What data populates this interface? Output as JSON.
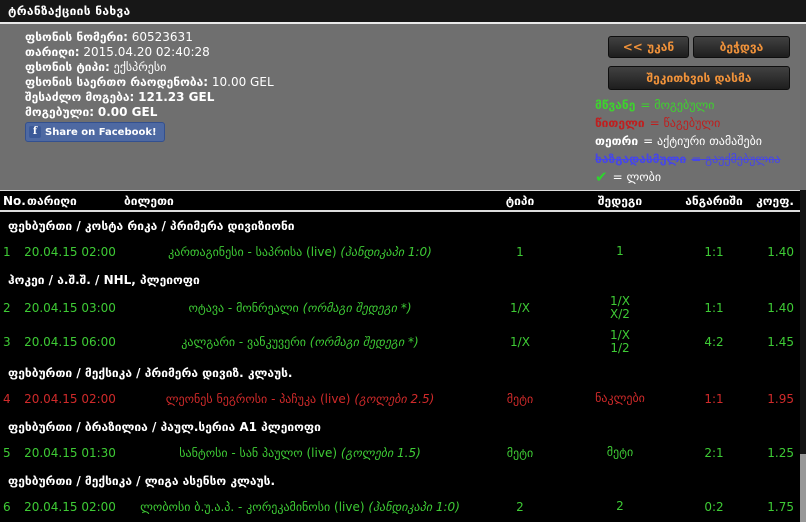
{
  "title": "ტრანზაქციის ნახვა",
  "colors": {
    "won_green": "#3ecb35",
    "lost_red": "#cf2a2a",
    "legend_green": "#3ed32e",
    "legend_red": "#bf1f1f",
    "legend_white": "#ffffff",
    "legend_blue": "#4646e8",
    "accent_orange": "#f0923a",
    "facebook_blue": "#4e69a2",
    "check_green": "#2ed32e"
  },
  "info": {
    "fields": [
      {
        "label": "ფსონის ნომერი:",
        "value": "60523631"
      },
      {
        "label": "თარიღი:",
        "value": "2015.04.20 02:40:28"
      },
      {
        "label": "ფსონის ტიპი:",
        "value": "ექსპრესი"
      },
      {
        "label": "ფსონის საერთო რაოდენობა:",
        "value": "10.00 GEL"
      },
      {
        "label": "შესაძლო მოგება:",
        "value": "121.23 GEL"
      },
      {
        "label": "მოგებული:",
        "value": "0.00 GEL"
      }
    ],
    "facebook_label": "Share on Facebook!",
    "facebook_icon": "f"
  },
  "actions": {
    "back_label": "<< უკან",
    "print_label": "ბეჭდვა",
    "ask_label": "შეკითხვის დასმა"
  },
  "legend": {
    "items": [
      {
        "term": "მწვანე",
        "rest": "= მოგებული",
        "color": "#3ed32e",
        "strike": false,
        "icon": ""
      },
      {
        "term": "წითელი",
        "rest": "= წაგებული",
        "color": "#bf1f1f",
        "strike": false,
        "icon": ""
      },
      {
        "term": "თეთრი",
        "rest": "= აქტიური თამაშები",
        "color": "#ffffff",
        "strike": false,
        "icon": ""
      },
      {
        "term": "ხაზგადასმული",
        "rest": "= გაუქმებულია",
        "color": "#4646e8",
        "strike": true,
        "icon": ""
      },
      {
        "term": "",
        "rest": "= ლობი",
        "color": "#ffffff",
        "strike": false,
        "icon": "checkmark",
        "icon_glyph": "✔"
      }
    ]
  },
  "table": {
    "columns": [
      "No.",
      "თარიღი",
      "ბილეთი",
      "ტიპი",
      "შედეგი",
      "ანგარიში",
      "კოეფ."
    ],
    "rows": [
      {
        "kind": "group",
        "label": "ფეხბურთი / კოსტა რიკა / პრიმერა დივიზიონი"
      },
      {
        "kind": "bet",
        "status": "won",
        "no": "1",
        "date": "20.04.15 02:00",
        "match": "კართაგინესი - საპრისა (live)",
        "note": "(ჰანდიკაპი 1:0)",
        "type": "1",
        "result": "1",
        "score": "1:1",
        "coef": "1.40"
      },
      {
        "kind": "group",
        "label": "ჰოკეი / ა.შ.შ. / NHL, პლეიოფი"
      },
      {
        "kind": "bet",
        "status": "won",
        "no": "2",
        "date": "20.04.15 03:00",
        "match": "ოტავა - მონრეალი",
        "note": "(ორმაგი შედეგი *)",
        "type": "1/X",
        "result": "1/X\nX/2",
        "score": "1:1",
        "coef": "1.40"
      },
      {
        "kind": "bet",
        "status": "won",
        "no": "3",
        "date": "20.04.15 06:00",
        "match": "კალგარი - ვანკუვერი",
        "note": "(ორმაგი შედეგი *)",
        "type": "1/X",
        "result": "1/X\n1/2",
        "score": "4:2",
        "coef": "1.45"
      },
      {
        "kind": "group",
        "label": "ფეხბურთი / მექსიკა / პრიმერა დივიზ. კლაუს."
      },
      {
        "kind": "bet",
        "status": "lost",
        "no": "4",
        "date": "20.04.15 02:00",
        "match": "ლეონეს ნეგროსი - პაჩუკა (live)",
        "note": "(გოლები 2.5)",
        "type": "მეტი",
        "result": "ნაკლები",
        "score": "1:1",
        "coef": "1.95"
      },
      {
        "kind": "group",
        "label": "ფეხბურთი / ბრაზილია / პაულ.სერია A1 პლეიოფი"
      },
      {
        "kind": "bet",
        "status": "won",
        "no": "5",
        "date": "20.04.15 01:30",
        "match": "სანტოსი - სან პაულო (live)",
        "note": "(გოლები 1.5)",
        "type": "მეტი",
        "result": "მეტი",
        "score": "2:1",
        "coef": "1.25"
      },
      {
        "kind": "group",
        "label": "ფეხბურთი / მექსიკა / ლიგა ასენსო კლაუს."
      },
      {
        "kind": "bet",
        "status": "won",
        "no": "6",
        "date": "20.04.15 02:00",
        "match": "ლობოსი ბ.უ.ა.პ. - კორეკამინოსი (live)",
        "note": "(ჰანდიკაპი 1:0)",
        "type": "2",
        "result": "2",
        "score": "0:2",
        "coef": "1.75"
      }
    ]
  }
}
